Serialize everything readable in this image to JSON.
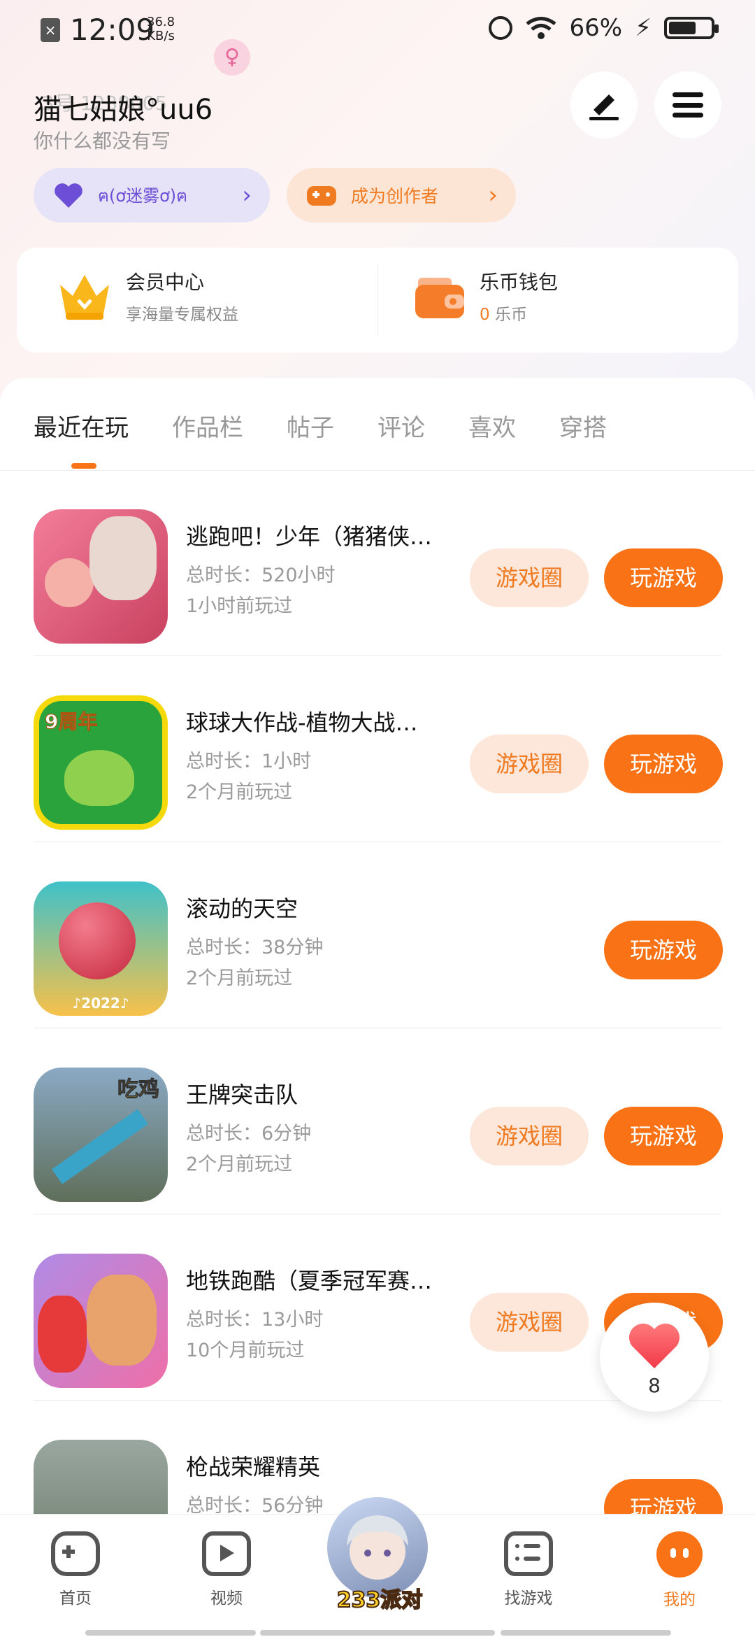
{
  "status_bar": {
    "time": "12:09",
    "net_speed_value": "36.8",
    "net_speed_unit": "KB/s",
    "battery": "66%",
    "battery_level": 0.66
  },
  "profile": {
    "name": "猫七姑娘°uu6",
    "user_id_partial": "3号 1238005",
    "bio": "你什么都没有写"
  },
  "pills": {
    "group_label": "ฅ(ơ迷雾ơ)ฅ",
    "creator_label": "成为创作者"
  },
  "vip": {
    "member_title": "会员中心",
    "member_sub": "享海量专属权益",
    "wallet_title": "乐币钱包",
    "wallet_amount": "0",
    "wallet_unit": "乐币"
  },
  "tabs": [
    "最近在玩",
    "作品栏",
    "帖子",
    "评论",
    "喜欢",
    "穿搭"
  ],
  "buttons": {
    "circle": "游戏圈",
    "play": "玩游戏"
  },
  "games": [
    {
      "name": "逃跑吧！少年（猪猪侠…",
      "time": "总时长：520小时",
      "last": "1小时前玩过",
      "has_circle": true,
      "icon_text": ""
    },
    {
      "name": "球球大作战-植物大战…",
      "time": "总时长：1小时",
      "last": "2个月前玩过",
      "has_circle": true,
      "icon_text": "9周年"
    },
    {
      "name": "滚动的天空",
      "time": "总时长：38分钟",
      "last": "2个月前玩过",
      "has_circle": false,
      "icon_text": "♪2022♪"
    },
    {
      "name": "王牌突击队",
      "time": "总时长：6分钟",
      "last": "2个月前玩过",
      "has_circle": true,
      "icon_text": "吃鸡"
    },
    {
      "name": "地铁跑酷（夏季冠军赛…",
      "time": "总时长：13小时",
      "last": "10个月前玩过",
      "has_circle": true,
      "icon_text": ""
    },
    {
      "name": "枪战荣耀精英",
      "time": "总时长：56分钟",
      "last": "",
      "has_circle": false,
      "icon_text": ""
    }
  ],
  "like": {
    "count": "8"
  },
  "nav": {
    "home": "首页",
    "video": "视频",
    "party": "233派对",
    "find": "找游戏",
    "mine": "我的"
  },
  "colors": {
    "accent": "#f97316",
    "circle_bg": "#fde7da",
    "purple_pill": "#e6e2f7"
  }
}
